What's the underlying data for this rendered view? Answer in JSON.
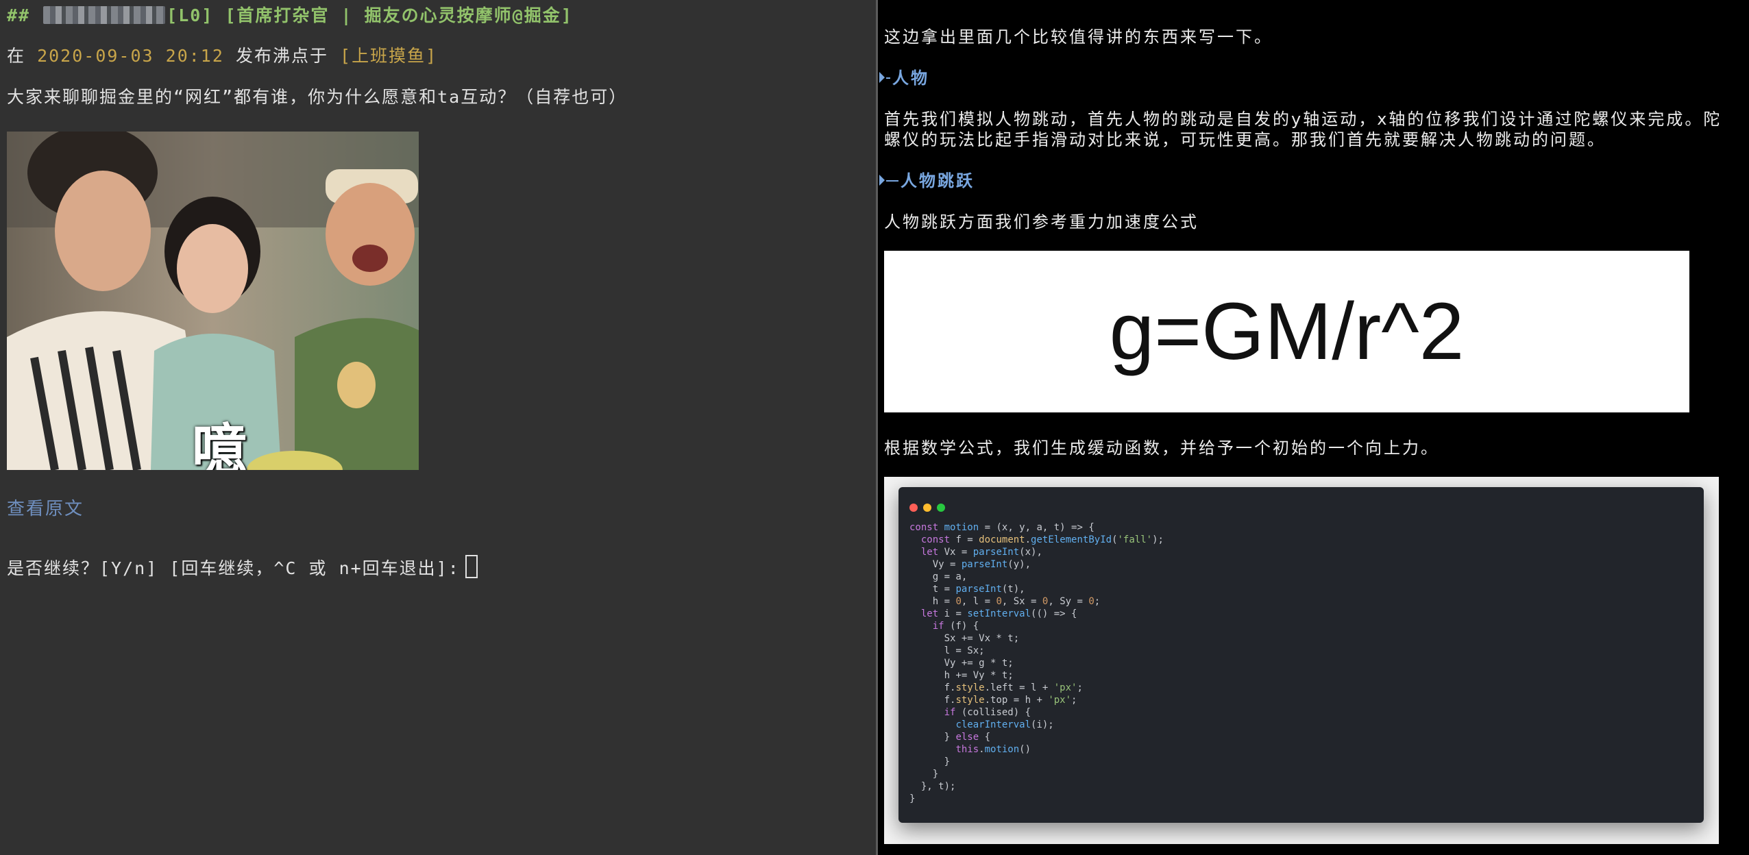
{
  "left_pane": {
    "header": {
      "prefix": "##",
      "tag": "[L0]",
      "title": "[首席打杂官 | 掘友の心灵按摩师@掘金]"
    },
    "meta": {
      "pre": "在",
      "datetime": "2020-09-03 20:12",
      "mid": "发布沸点于",
      "topic": "[上班摸鱼]"
    },
    "question": "大家来聊聊掘金里的“网红”都有谁，你为什么愿意和ta互动？（自荐也可）",
    "meme_caption": "噫",
    "view_original": "查看原文",
    "prompt": "是否继续？[Y/n] [回车继续，^C 或 n+回车退出]:"
  },
  "right_pane": {
    "intro": "这边拿出里面几个比较值得讲的东西来写一下。",
    "section1": "人物",
    "para1_line1": "首先我们模拟人物跳动，首先人物的跳动是自发的y轴运动，x轴的位移我们设计通过陀螺仪来完成。陀",
    "para1_line2": "螺仪的玩法比起手指滑动对比来说，可玩性更高。那我们首先就要解决人物跳动的问题。",
    "section2": "人物跳跃",
    "para2": "人物跳跃方面我们参考重力加速度公式",
    "formula": "g=GM/r^2",
    "para3": "根据数学公式，我们生成缓动函数，并给予一个初始的一个向上力。",
    "code_dots": [
      "#ff5f57",
      "#febc2e",
      "#28c840"
    ],
    "code_lines": [
      "const motion = (x, y, a, t) => {",
      "  const f = document.getElementById('fall');",
      "  let Vx = parseInt(x),",
      "    Vy = parseInt(y),",
      "    g = a,",
      "    t = parseInt(t),",
      "    h = 0, l = 0, Sx = 0, Sy = 0;",
      "  let i = setInterval(() => {",
      "    if (f) {",
      "      Sx += Vx * t;",
      "      l = Sx;",
      "      Vy += g * t;",
      "      h += Vy * t;",
      "      f.style.left = l + 'px';",
      "      f.style.top = h + 'px';",
      "      if (collised) {",
      "        clearInterval(i);",
      "      } else {",
      "        this.motion()",
      "      }",
      "    }",
      "  }, t);",
      "}"
    ]
  }
}
